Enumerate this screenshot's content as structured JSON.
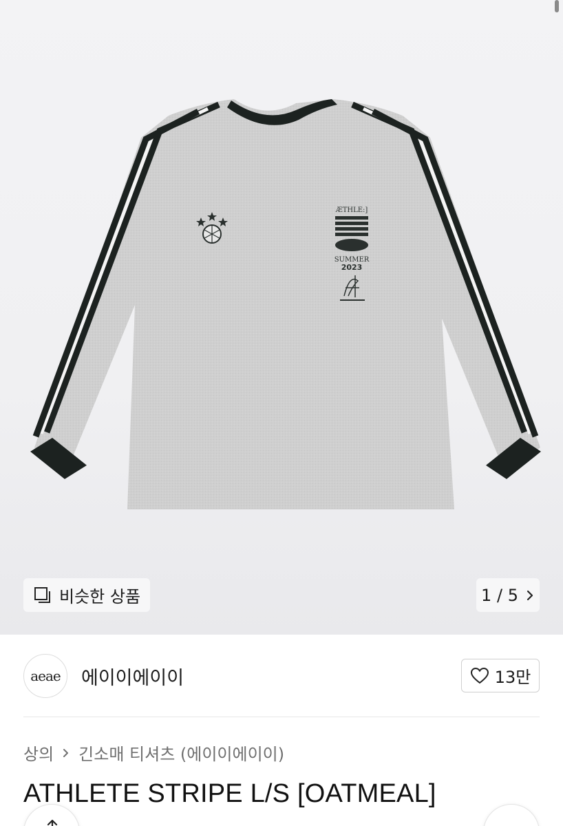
{
  "gallery": {
    "similar_label": "비슷한 상품",
    "page_current": "1",
    "page_sep": "/",
    "page_total": "5",
    "print_text": {
      "brand_mark": "ÆTHLE:]",
      "season": "SUMMER",
      "year": "2023"
    }
  },
  "store": {
    "logo_text": "aeae",
    "name": "에이이에이이",
    "likes": "13만"
  },
  "breadcrumb": {
    "category": "상의",
    "subcategory": "긴소매 티셔츠 (에이이에이이)"
  },
  "product": {
    "title": "ATHLETE STRIPE L/S [OATMEAL]"
  },
  "icons": [
    "similar-items-icon",
    "chevron-right-icon",
    "heart-icon",
    "share-icon"
  ],
  "colors": {
    "shirt": "#cfcfcf",
    "trim": "#1c2220",
    "background": "#f1f1f3"
  }
}
